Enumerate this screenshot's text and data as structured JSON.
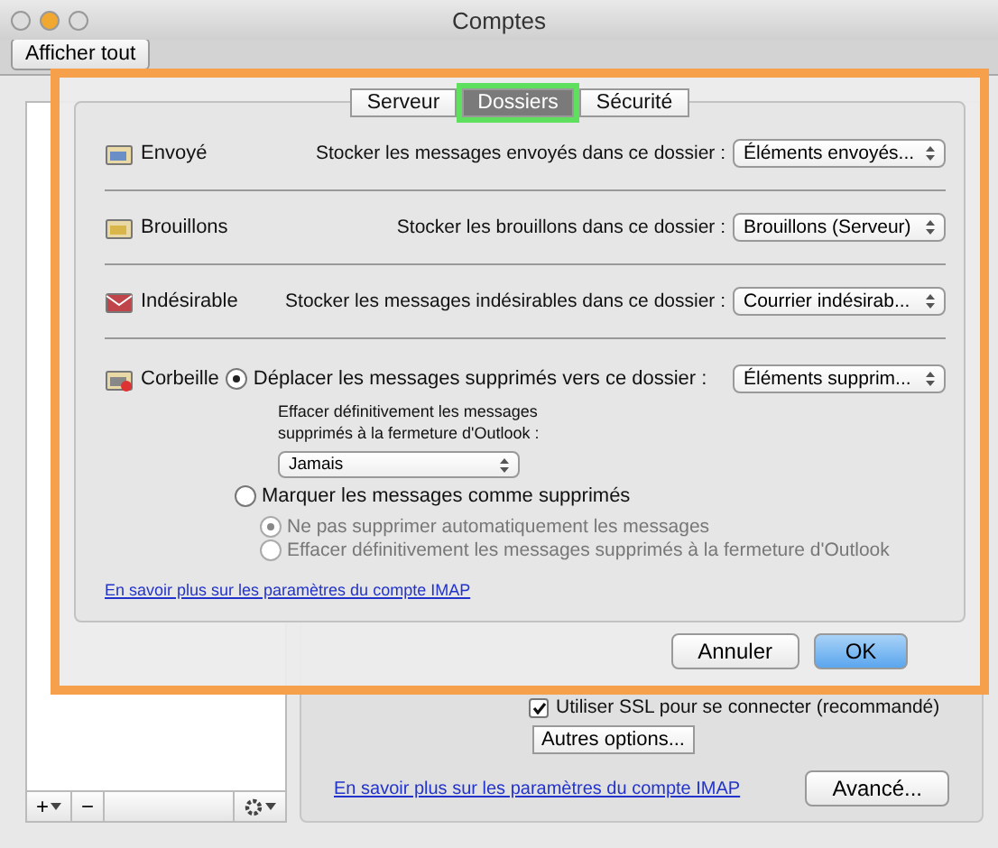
{
  "window": {
    "title": "Comptes"
  },
  "toolbar": {
    "button": "Afficher tout"
  },
  "sidebar": {
    "footer": [
      {
        "kind": "add",
        "label": "+"
      },
      {
        "kind": "remove",
        "label": "−"
      },
      {
        "kind": "gear"
      }
    ]
  },
  "account": {
    "ssl": {
      "label": "Utiliser SSL pour se connecter (recommandé)",
      "checked": true
    },
    "options_button": "Autres options...",
    "link": "En savoir plus sur les paramètres du compte IMAP",
    "advanced_button": "Avancé..."
  },
  "sheet": {
    "tabs": [
      {
        "label": "Serveur",
        "selected": false
      },
      {
        "label": "Dossiers",
        "selected": true
      },
      {
        "label": "Sécurité",
        "selected": false
      }
    ],
    "folders": [
      {
        "kind": "sent",
        "label": "Envoyé",
        "description": "Stocker les messages envoyés dans ce dossier :",
        "popup": "Éléments envoyés..."
      },
      {
        "kind": "drafts",
        "label": "Brouillons",
        "description": "Stocker les brouillons dans ce dossier :",
        "popup": "Brouillons (Serveur)"
      },
      {
        "kind": "junk",
        "label": "Indésirable",
        "description": "Stocker les messages indésirables dans ce dossier :",
        "popup": "Courrier indésirab..."
      }
    ],
    "trash": {
      "label": "Corbeille",
      "move": {
        "label": "Déplacer les messages supprimés vers ce dossier :",
        "selected": true,
        "popup": "Éléments supprim...",
        "note": "Effacer définitivement les messages supprimés à la fermeture d'Outlook :",
        "note_popup": "Jamais"
      },
      "mark": {
        "label": "Marquer les messages comme supprimés",
        "selected": false,
        "suboptions": [
          {
            "label": "Ne pas supprimer automatiquement les messages",
            "selected": true,
            "disabled": true
          },
          {
            "label": "Effacer définitivement les messages supprimés à la fermeture d'Outlook",
            "selected": false,
            "disabled": true
          }
        ]
      }
    },
    "link": "En savoir plus sur les paramètres du compte IMAP",
    "buttons": [
      {
        "label": "Annuler",
        "kind": "cancel"
      },
      {
        "label": "OK",
        "kind": "default"
      }
    ]
  }
}
